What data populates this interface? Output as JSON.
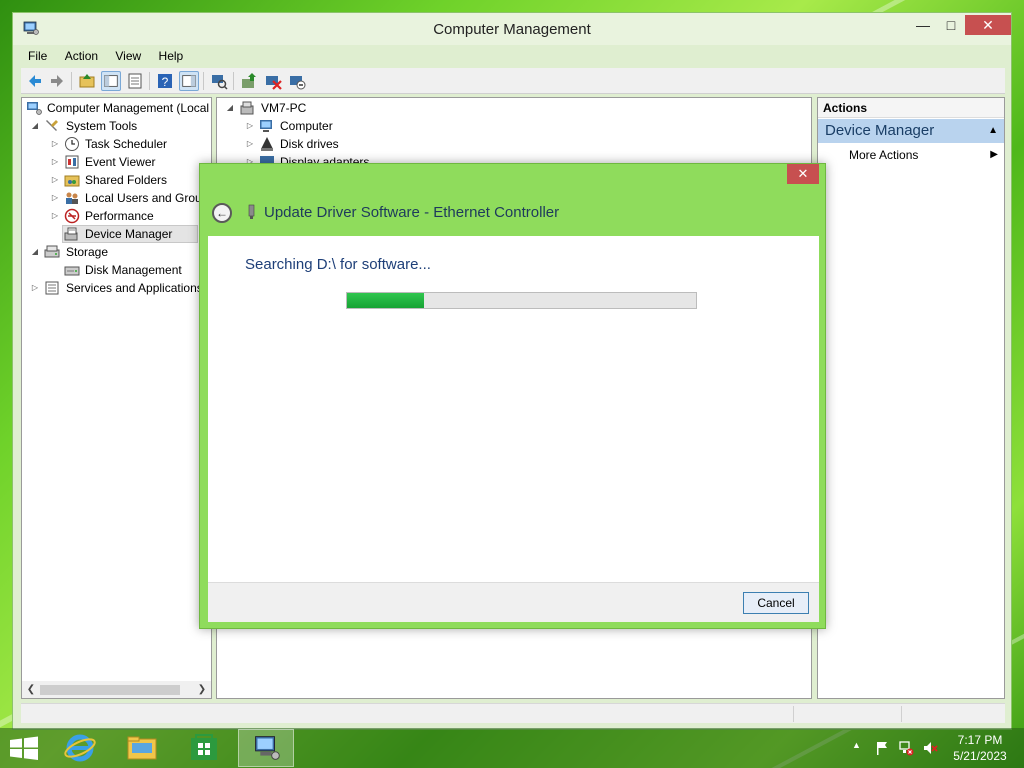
{
  "window": {
    "title": "Computer Management",
    "controls": {
      "minimize": "—",
      "maximize": "□",
      "close": "✕"
    }
  },
  "menu": [
    "File",
    "Action",
    "View",
    "Help"
  ],
  "toolbar_icons": [
    "back-arrow-icon",
    "forward-arrow-icon",
    "up-folder-icon",
    "show-hide-tree-icon",
    "properties-icon",
    "help-icon",
    "action-pane-icon",
    "scan-hardware-icon",
    "update-driver-icon",
    "uninstall-icon",
    "disable-device-icon"
  ],
  "tree": {
    "root": "Computer Management (Local",
    "system_tools": "System Tools",
    "task_scheduler": "Task Scheduler",
    "event_viewer": "Event Viewer",
    "shared_folders": "Shared Folders",
    "local_users": "Local Users and Group",
    "performance": "Performance",
    "device_manager": "Device Manager",
    "storage": "Storage",
    "disk_management": "Disk Management",
    "services": "Services and Applications"
  },
  "devices": {
    "root": "VM7-PC",
    "computer": "Computer",
    "disk_drives": "Disk drives",
    "display_adapters": "Display adapters"
  },
  "actions": {
    "header": "Actions",
    "device_manager": "Device Manager",
    "more_actions": "More Actions"
  },
  "dialog": {
    "title": "Update Driver Software - Ethernet Controller",
    "status_text": "Searching D:\\ for software...",
    "progress": 0.22,
    "cancel": "Cancel",
    "close": "✕"
  },
  "taskbar": {
    "time": "7:17 PM",
    "date": "5/21/2023",
    "apps": [
      "windows-start-icon",
      "internet-explorer-icon",
      "file-explorer-icon",
      "store-icon",
      "computer-management-icon"
    ]
  },
  "colors": {
    "accent_green": "#8fdc5c",
    "close_red": "#c75050",
    "progress_green": "#17a334",
    "selection_blue": "#b9d3ee"
  }
}
